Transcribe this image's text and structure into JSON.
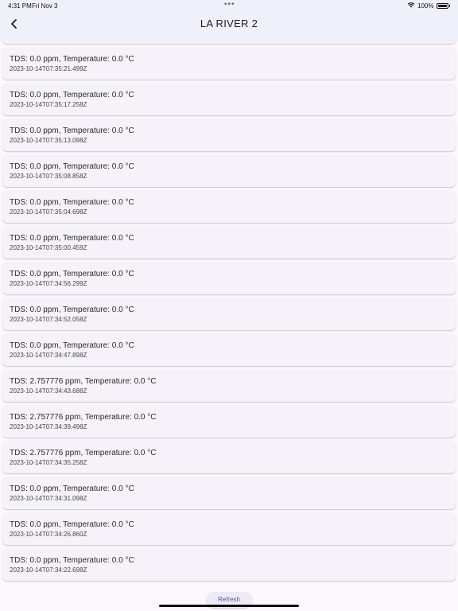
{
  "status_bar": {
    "time": "4:31 PM",
    "date": "Fri Nov 3",
    "dots": "•••",
    "battery_text": "100%",
    "battery_level": 1.0
  },
  "header": {
    "title": "LA RIVER 2",
    "back_icon": "chevron-left-icon"
  },
  "readings": [
    {
      "title": "TDS: 0.0 ppm, Temperature: 0.0 °C",
      "timestamp": "2023-10-14T07:35:21.499Z"
    },
    {
      "title": "TDS: 0.0 ppm, Temperature: 0.0 °C",
      "timestamp": "2023-10-14T07:35:17.258Z"
    },
    {
      "title": "TDS: 0.0 ppm, Temperature: 0.0 °C",
      "timestamp": "2023-10-14T07:35:13.098Z"
    },
    {
      "title": "TDS: 0.0 ppm, Temperature: 0.0 °C",
      "timestamp": "2023-10-14T07:35:08.858Z"
    },
    {
      "title": "TDS: 0.0 ppm, Temperature: 0.0 °C",
      "timestamp": "2023-10-14T07:35:04.698Z"
    },
    {
      "title": "TDS: 0.0 ppm, Temperature: 0.0 °C",
      "timestamp": "2023-10-14T07:35:00.459Z"
    },
    {
      "title": "TDS: 0.0 ppm, Temperature: 0.0 °C",
      "timestamp": "2023-10-14T07:34:56.299Z"
    },
    {
      "title": "TDS: 0.0 ppm, Temperature: 0.0 °C",
      "timestamp": "2023-10-14T07:34:52.058Z"
    },
    {
      "title": "TDS: 0.0 ppm, Temperature: 0.0 °C",
      "timestamp": "2023-10-14T07:34:47.898Z"
    },
    {
      "title": "TDS: 2.757776 ppm, Temperature: 0.0 °C",
      "timestamp": "2023-10-14T07:34:43.688Z"
    },
    {
      "title": "TDS: 2.757776 ppm, Temperature: 0.0 °C",
      "timestamp": "2023-10-14T07:34:39.498Z"
    },
    {
      "title": "TDS: 2.757776 ppm, Temperature: 0.0 °C",
      "timestamp": "2023-10-14T07:34:35.258Z"
    },
    {
      "title": "TDS: 0.0 ppm, Temperature: 0.0 °C",
      "timestamp": "2023-10-14T07:34:31.098Z"
    },
    {
      "title": "TDS: 0.0 ppm, Temperature: 0.0 °C",
      "timestamp": "2023-10-14T07:34:26.860Z"
    },
    {
      "title": "TDS: 0.0 ppm, Temperature: 0.0 °C",
      "timestamp": "2023-10-14T07:34:22.698Z"
    }
  ],
  "footer": {
    "refresh_label": "Refresh"
  },
  "colors": {
    "app_bar": "#eef0fa",
    "background": "#fdf8fd",
    "card": "#f5f2fa",
    "accent": "#4d5fa8"
  }
}
